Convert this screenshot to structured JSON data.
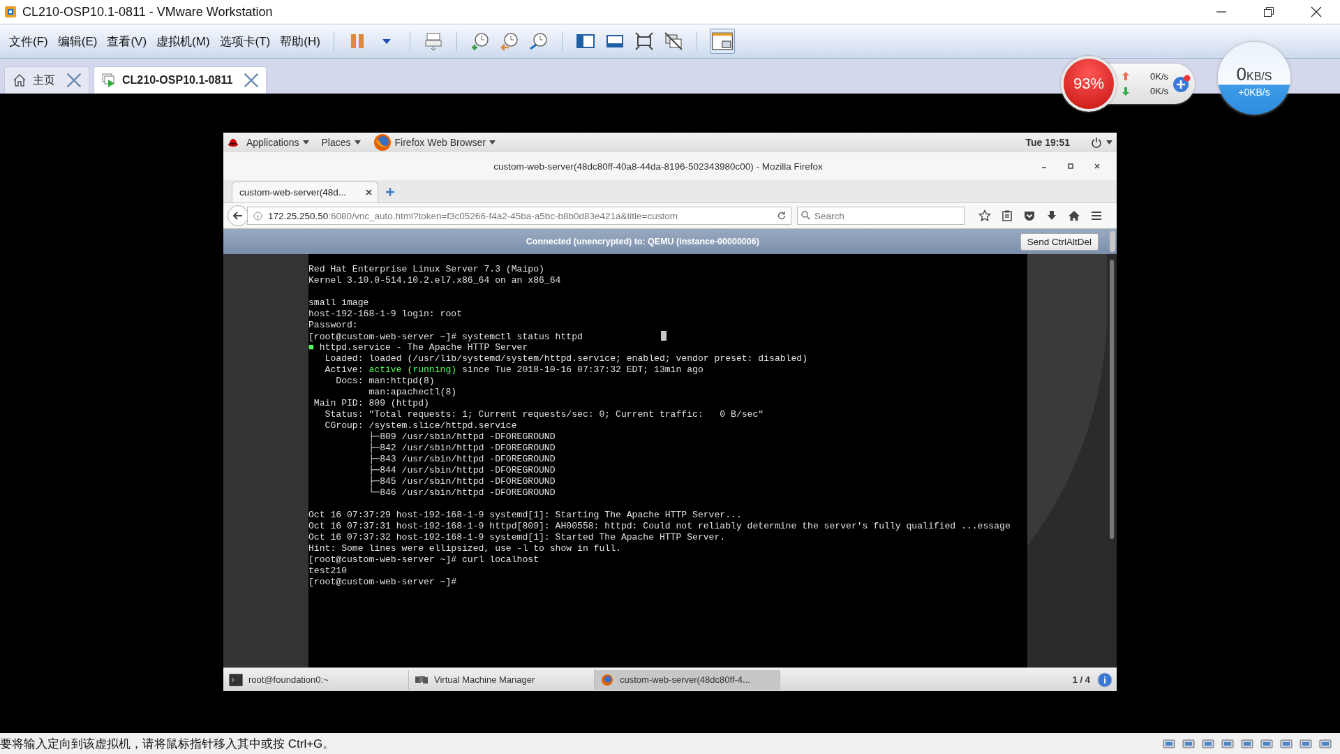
{
  "window": {
    "title": "CL210-OSP10.1-0811 - VMware Workstation"
  },
  "menu": [
    "文件(F)",
    "编辑(E)",
    "查看(V)",
    "虚拟机(M)",
    "选项卡(T)",
    "帮助(H)"
  ],
  "tabs": [
    {
      "label": "主页",
      "kind": "home",
      "selected": false
    },
    {
      "label": "CL210-OSP10.1-0811",
      "kind": "vm",
      "selected": true
    }
  ],
  "speed_widget": {
    "percent": "93%",
    "upload": "0K/s",
    "download": "0K/s"
  },
  "speed_ball": {
    "value": "0",
    "unit": "KB/S",
    "sub": "+0KB/s"
  },
  "guest": {
    "top_bar": {
      "menus": [
        "Applications",
        "Places",
        "Firefox Web Browser"
      ],
      "clock": "Tue 19:51"
    },
    "firefox": {
      "title": "custom-web-server(48dc80ff-40a8-44da-8196-502343980c00) - Mozilla Firefox",
      "tabs": [
        {
          "label": "custom-web-server(48d...",
          "selected": true
        }
      ],
      "url_host": "172.25.250.50",
      "url_rest": ":6080/vnc_auto.html?token=f3c05266-f4a2-45ba-a5bc-b8b0d83e421a&title=custom",
      "search": {
        "placeholder": "Search"
      }
    },
    "vnc": {
      "status": "Connected (unencrypted) to: QEMU (instance-00000006)",
      "button": "Send CtrlAltDel"
    },
    "console": [
      {
        "kind": "text",
        "parts": [
          {
            "kind": "plain",
            "text": "Red Hat Enterprise Linux Server 7.3 (Maipo)"
          }
        ]
      },
      {
        "kind": "text",
        "parts": [
          {
            "kind": "plain",
            "text": "Kernel 3.10.0-514.10.2.el7.x86_64 on an x86_64"
          }
        ]
      },
      {
        "kind": "blank"
      },
      {
        "kind": "text",
        "parts": [
          {
            "kind": "plain",
            "text": "small image"
          }
        ]
      },
      {
        "kind": "text",
        "parts": [
          {
            "kind": "plain",
            "text": "host-192-168-1-9 login: root"
          }
        ]
      },
      {
        "kind": "text",
        "parts": [
          {
            "kind": "plain",
            "text": "Password:"
          }
        ]
      },
      {
        "kind": "text",
        "cursor": true,
        "parts": [
          {
            "kind": "plain",
            "text": "[root@custom-web-server ~]# systemctl status httpd"
          }
        ]
      },
      {
        "kind": "text",
        "parts": [
          {
            "kind": "ok",
            "text": "■"
          },
          {
            "kind": "plain",
            "text": " httpd.service - The Apache HTTP Server"
          }
        ]
      },
      {
        "kind": "text",
        "parts": [
          {
            "kind": "plain",
            "text": "   Loaded: loaded (/usr/lib/systemd/system/httpd.service; enabled; vendor preset: disabled)"
          }
        ]
      },
      {
        "kind": "text",
        "parts": [
          {
            "kind": "plain",
            "text": "   Active: "
          },
          {
            "kind": "ok",
            "text": "active (running)"
          },
          {
            "kind": "plain",
            "text": " since Tue 2018-10-16 07:37:32 EDT; 13min ago"
          }
        ]
      },
      {
        "kind": "text",
        "parts": [
          {
            "kind": "plain",
            "text": "     Docs: man:httpd(8)"
          }
        ]
      },
      {
        "kind": "text",
        "parts": [
          {
            "kind": "plain",
            "text": "           man:apachectl(8)"
          }
        ]
      },
      {
        "kind": "text",
        "parts": [
          {
            "kind": "plain",
            "text": " Main PID: 809 (httpd)"
          }
        ]
      },
      {
        "kind": "text",
        "parts": [
          {
            "kind": "plain",
            "text": "   Status: \"Total requests: 1; Current requests/sec: 0; Current traffic:   0 B/sec\""
          }
        ]
      },
      {
        "kind": "text",
        "parts": [
          {
            "kind": "plain",
            "text": "   CGroup: /system.slice/httpd.service"
          }
        ]
      },
      {
        "kind": "text",
        "parts": [
          {
            "kind": "plain",
            "text": "           ├─809 /usr/sbin/httpd -DFOREGROUND"
          }
        ]
      },
      {
        "kind": "text",
        "parts": [
          {
            "kind": "plain",
            "text": "           ├─842 /usr/sbin/httpd -DFOREGROUND"
          }
        ]
      },
      {
        "kind": "text",
        "parts": [
          {
            "kind": "plain",
            "text": "           ├─843 /usr/sbin/httpd -DFOREGROUND"
          }
        ]
      },
      {
        "kind": "text",
        "parts": [
          {
            "kind": "plain",
            "text": "           ├─844 /usr/sbin/httpd -DFOREGROUND"
          }
        ]
      },
      {
        "kind": "text",
        "parts": [
          {
            "kind": "plain",
            "text": "           ├─845 /usr/sbin/httpd -DFOREGROUND"
          }
        ]
      },
      {
        "kind": "text",
        "parts": [
          {
            "kind": "plain",
            "text": "           └─846 /usr/sbin/httpd -DFOREGROUND"
          }
        ]
      },
      {
        "kind": "blank"
      },
      {
        "kind": "text",
        "parts": [
          {
            "kind": "plain",
            "text": "Oct 16 07:37:29 host-192-168-1-9 systemd[1]: Starting The Apache HTTP Server..."
          }
        ]
      },
      {
        "kind": "text",
        "parts": [
          {
            "kind": "plain",
            "text": "Oct 16 07:37:31 host-192-168-1-9 httpd[809]: AH00558: httpd: Could not reliably determine the server's fully qualified ...essage"
          }
        ]
      },
      {
        "kind": "text",
        "parts": [
          {
            "kind": "plain",
            "text": "Oct 16 07:37:32 host-192-168-1-9 systemd[1]: Started The Apache HTTP Server."
          }
        ]
      },
      {
        "kind": "text",
        "parts": [
          {
            "kind": "plain",
            "text": "Hint: Some lines were ellipsized, use -l to show in full."
          }
        ]
      },
      {
        "kind": "text",
        "parts": [
          {
            "kind": "plain",
            "text": "[root@custom-web-server ~]# curl localhost"
          }
        ]
      },
      {
        "kind": "text",
        "parts": [
          {
            "kind": "plain",
            "text": "test210"
          }
        ]
      },
      {
        "kind": "text",
        "parts": [
          {
            "kind": "plain",
            "text": "[root@custom-web-server ~]#"
          }
        ]
      }
    ],
    "taskbar": [
      {
        "label": "root@foundation0:~",
        "kind": "terminal",
        "selected": false
      },
      {
        "label": "Virtual Machine Manager",
        "kind": "vmm",
        "selected": false
      },
      {
        "label": "custom-web-server(48dc80ff-4...",
        "kind": "firefox",
        "selected": true
      }
    ],
    "workspace": "1 / 4"
  },
  "status_bar": {
    "text": "要将输入定向到该虚拟机，请将鼠标指针移入其中或按 Ctrl+G。"
  }
}
